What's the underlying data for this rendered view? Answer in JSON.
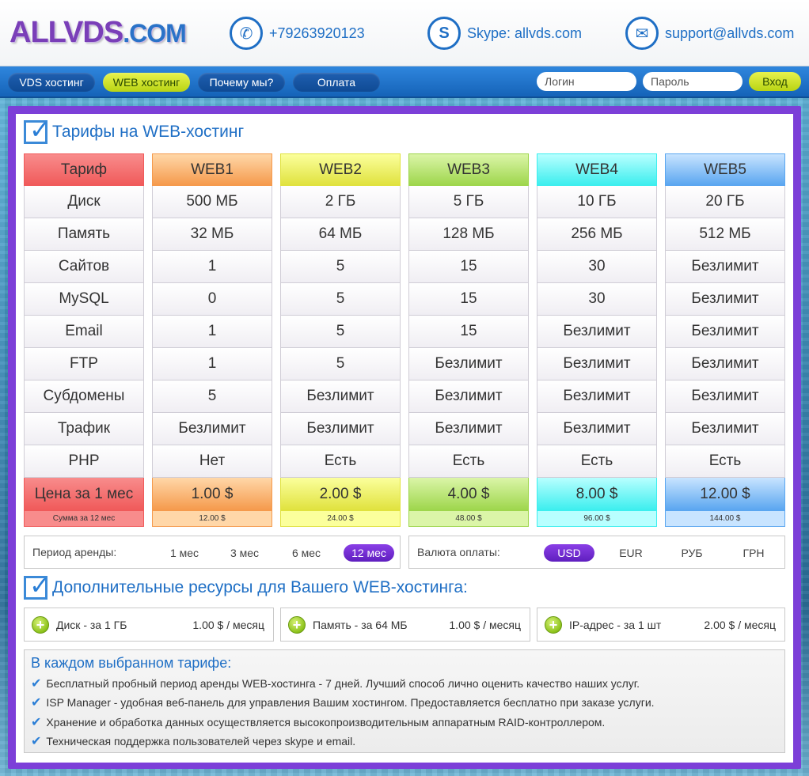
{
  "header": {
    "logo_main": "ALLVDS",
    "logo_suffix": ".COM",
    "phone": "+79263920123",
    "skype": "Skype: allvds.com",
    "email": "support@allvds.com"
  },
  "nav": {
    "items": [
      "VDS хостинг",
      "WEB хостинг",
      "Почему мы?",
      "Оплата"
    ],
    "login_placeholder": "Логин",
    "password_placeholder": "Пароль",
    "login_button": "Вход"
  },
  "tariffs": {
    "title": "Тарифы на WEB-хостинг",
    "columns": [
      {
        "name": "Тариф",
        "color_top": "#f88c8c",
        "color_bottom": "#f05a5a",
        "cells": [
          "Диск",
          "Память",
          "Сайтов",
          "MySQL",
          "Email",
          "FTP",
          "Субдомены",
          "Трафик",
          "PHP"
        ],
        "price": "Цена за 1 мес",
        "sum": "Сумма за 12 мес"
      },
      {
        "name": "WEB1",
        "color_top": "#ffd7a8",
        "color_bottom": "#f59a4c",
        "cells": [
          "500 МБ",
          "32 МБ",
          "1",
          "0",
          "1",
          "1",
          "5",
          "Безлимит",
          "Нет"
        ],
        "price": "1.00 $",
        "sum": "12.00 $"
      },
      {
        "name": "WEB2",
        "color_top": "#fbff9c",
        "color_bottom": "#e0e23e",
        "cells": [
          "2 ГБ",
          "64 МБ",
          "5",
          "5",
          "5",
          "5",
          "Безлимит",
          "Безлимит",
          "Есть"
        ],
        "price": "2.00 $",
        "sum": "24.00 $"
      },
      {
        "name": "WEB3",
        "color_top": "#dbf5a8",
        "color_bottom": "#9ed64c",
        "cells": [
          "5 ГБ",
          "128 МБ",
          "15",
          "15",
          "15",
          "Безлимит",
          "Безлимит",
          "Безлимит",
          "Есть"
        ],
        "price": "4.00 $",
        "sum": "48.00 $"
      },
      {
        "name": "WEB4",
        "color_top": "#b8ffff",
        "color_bottom": "#3ceeee",
        "cells": [
          "10 ГБ",
          "256 МБ",
          "30",
          "30",
          "Безлимит",
          "Безлимит",
          "Безлимит",
          "Безлимит",
          "Есть"
        ],
        "price": "8.00 $",
        "sum": "96.00 $"
      },
      {
        "name": "WEB5",
        "color_top": "#c8e4ff",
        "color_bottom": "#5aa6f0",
        "cells": [
          "20 ГБ",
          "512 МБ",
          "Безлимит",
          "Безлимит",
          "Безлимит",
          "Безлимит",
          "Безлимит",
          "Безлимит",
          "Есть"
        ],
        "price": "12.00 $",
        "sum": "144.00 $"
      }
    ]
  },
  "period": {
    "label": "Период аренды:",
    "options": [
      "1 мес",
      "3 мес",
      "6 мес",
      "12 мес"
    ],
    "selected": "12 мес"
  },
  "currency": {
    "label": "Валюта оплаты:",
    "options": [
      "USD",
      "EUR",
      "РУБ",
      "ГРН"
    ],
    "selected": "USD"
  },
  "extras": {
    "title": "Дополнительные ресурсы для Вашего WEB-хостинга:",
    "items": [
      {
        "label": "Диск - за 1 ГБ",
        "price": "1.00 $ / месяц"
      },
      {
        "label": "Память - за 64 МБ",
        "price": "1.00 $ / месяц"
      },
      {
        "label": "IP-адрес - за 1 шт",
        "price": "2.00 $ / месяц"
      }
    ]
  },
  "features": {
    "title": "В каждом выбранном тарифе:",
    "items": [
      "Бесплатный пробный период аренды WEB-хостинга - 7 дней. Лучший способ лично оценить качество наших услуг.",
      "ISP Manager - удобная веб-панель для управления Вашим хостингом. Предоставляется бесплатно при заказе услуги.",
      "Хранение и обработка данных осуществляется высокопроизводительным аппаратным RAID-контроллером.",
      "Техническая поддержка пользователей через skype и email."
    ]
  },
  "colors": {
    "accent_blue": "#1f6fc5",
    "frame_purple": "#7c3fd8",
    "selected_purple": "#6a2fd0",
    "nav_active": "#d4e62a"
  }
}
